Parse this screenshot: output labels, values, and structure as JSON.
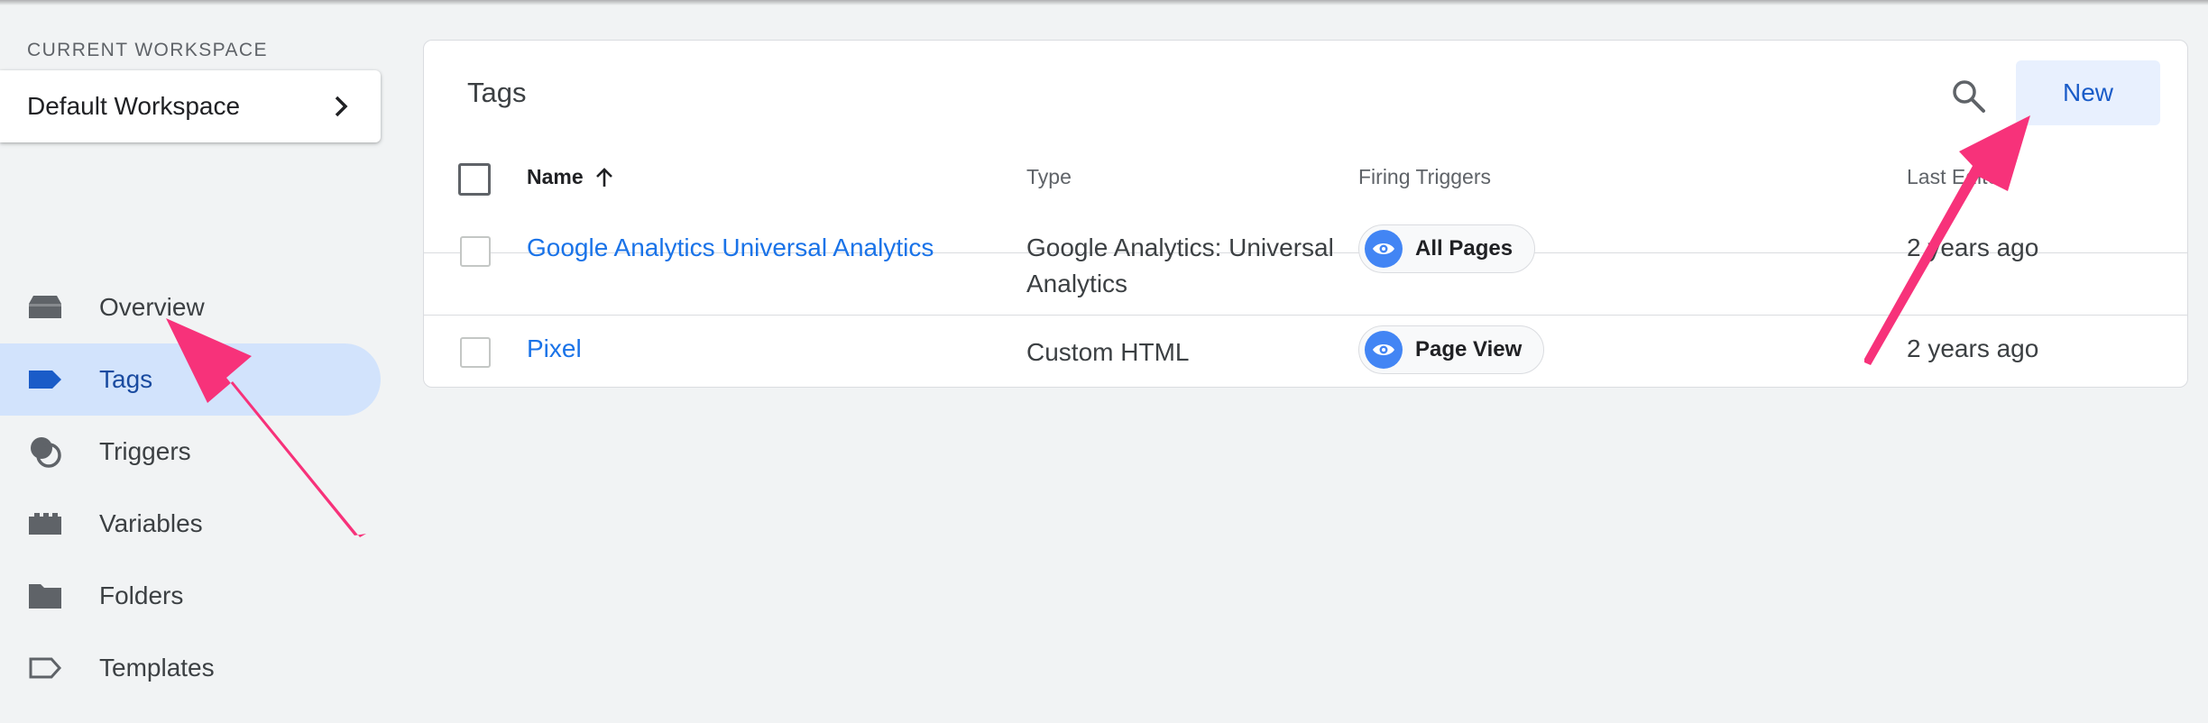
{
  "sidebar": {
    "workspace_label": "CURRENT WORKSPACE",
    "workspace_name": "Default Workspace",
    "items": [
      {
        "label": "Overview",
        "icon": "overview-icon"
      },
      {
        "label": "Tags",
        "icon": "tag-icon",
        "active": true
      },
      {
        "label": "Triggers",
        "icon": "trigger-icon"
      },
      {
        "label": "Variables",
        "icon": "variables-icon"
      },
      {
        "label": "Folders",
        "icon": "folder-icon"
      },
      {
        "label": "Templates",
        "icon": "template-icon"
      }
    ]
  },
  "main": {
    "title": "Tags",
    "new_label": "New",
    "columns": {
      "name": "Name",
      "type": "Type",
      "triggers": "Firing Triggers",
      "last_edited": "Last Edited"
    },
    "rows": [
      {
        "name": "Google Analytics Universal Analytics",
        "type": "Google Analytics: Universal Analytics",
        "trigger": "All Pages",
        "last_edited": "2 years ago"
      },
      {
        "name": "Pixel",
        "type": "Custom HTML",
        "trigger": "Page View",
        "last_edited": "2 years ago"
      }
    ]
  },
  "colors": {
    "accent": "#1a73e8",
    "active_nav": "#d2e3fc",
    "annotation_arrow": "#f7327a"
  }
}
